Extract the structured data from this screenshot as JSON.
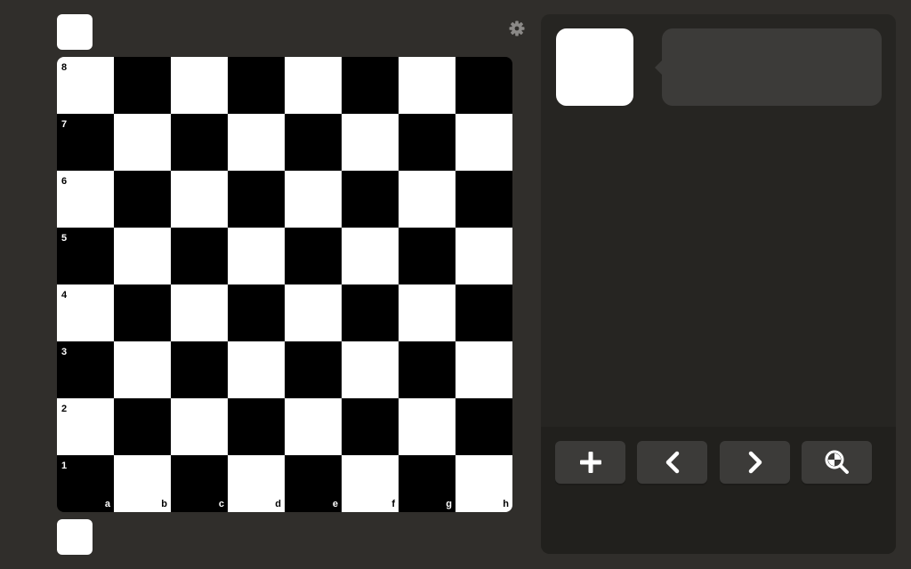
{
  "board": {
    "ranks": [
      "8",
      "7",
      "6",
      "5",
      "4",
      "3",
      "2",
      "1"
    ],
    "files": [
      "a",
      "b",
      "c",
      "d",
      "e",
      "f",
      "g",
      "h"
    ],
    "light_color": "#ffffff",
    "dark_color": "#000000"
  },
  "icons": {
    "settings": "gear-icon",
    "new_game": "plus-icon",
    "previous": "chevron-left-icon",
    "next": "chevron-right-icon",
    "analysis": "magnify-analysis-icon"
  },
  "colors": {
    "background": "#302e2b",
    "panel": "#262522",
    "button": "#3c3b39",
    "icon": "#ffffff"
  }
}
